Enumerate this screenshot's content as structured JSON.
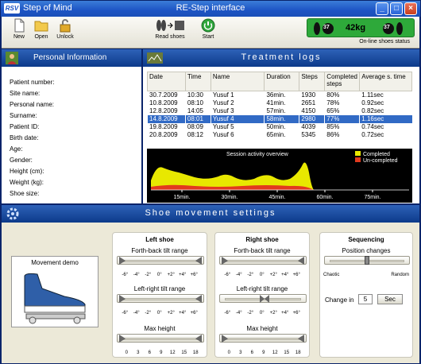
{
  "window": {
    "app_name": "Step of Mind",
    "title": "RE-Step interface",
    "logo_text": "RSV"
  },
  "toolbar": {
    "new_label": "New",
    "open_label": "Open",
    "unlock_label": "Unlock",
    "read_shoes_label": "Read shoes",
    "start_label": "Start",
    "status_label": "On-line shoes status",
    "status_left_text": "37",
    "status_weight_text": "42kg",
    "status_right_text": "37"
  },
  "personal_info": {
    "title": "Personal Information",
    "fields": [
      "Patient number:",
      "Site name:",
      "Personal name:",
      "Surname:",
      "Patient ID:",
      "Birth date:",
      "Age:",
      "Gender:",
      "Height (cm):",
      "Weight (kg):",
      "Shoe size:"
    ]
  },
  "treatment_logs": {
    "title": "Treatment logs",
    "columns": [
      "Date",
      "Time",
      "Name",
      "Duration",
      "Steps",
      "Completed steps",
      "Average s. time"
    ],
    "rows": [
      [
        "30.7.2009",
        "10:30",
        "Yusuf 1",
        "36min.",
        "1930",
        "80%",
        "1.11sec"
      ],
      [
        "10.8.2009",
        "08:10",
        "Yusuf 2",
        "41min.",
        "2651",
        "78%",
        "0.92sec"
      ],
      [
        "12.8.2009",
        "14:05",
        "Yusuf 3",
        "57min.",
        "4150",
        "65%",
        "0.82sec"
      ],
      [
        "14.8.2009",
        "08:01",
        "Yusuf 4",
        "58min.",
        "2980",
        "77%",
        "1.16sec"
      ],
      [
        "19.8.2009",
        "08:09",
        "Yusuf 5",
        "50min.",
        "4039",
        "85%",
        "0.74sec"
      ],
      [
        "20.8.2009",
        "08:12",
        "Yusuf 6",
        "65min.",
        "5345",
        "86%",
        "0.72sec"
      ]
    ],
    "selected_row": 3
  },
  "chart_data": {
    "type": "area",
    "title": "Session activity overview",
    "xlabel": "",
    "ylabel": "",
    "x_ticks": [
      "15min.",
      "30min.",
      "45min.",
      "60min.",
      "75min."
    ],
    "series": [
      {
        "name": "Completed",
        "color": "#e8e800"
      },
      {
        "name": "Un-completed",
        "color": "#e23a1e"
      }
    ]
  },
  "shoe_settings": {
    "title": "Shoe movement settings",
    "movement_demo_label": "Movement demo",
    "left_shoe": {
      "title": "Left shoe",
      "fb_label": "Forth-back tilt range",
      "lr_label": "Left-right tilt range",
      "mh_label": "Max height",
      "tilt_scale": [
        "-6°",
        "-4°",
        "-2°",
        "0°",
        "+2°",
        "+4°",
        "+6°"
      ],
      "height_scale": [
        "0",
        "3",
        "6",
        "9",
        "12",
        "15",
        "18"
      ]
    },
    "right_shoe": {
      "title": "Right shoe",
      "fb_label": "Forth-back tilt range",
      "lr_label": "Left-right tilt range",
      "mh_label": "Max height",
      "tilt_scale": [
        "-6°",
        "-4°",
        "-2°",
        "0°",
        "+2°",
        "+4°",
        "+6°"
      ],
      "height_scale": [
        "0",
        "3",
        "6",
        "9",
        "12",
        "15",
        "18"
      ]
    },
    "sequencing": {
      "title": "Sequencing",
      "position_label": "Position changes",
      "min_label": "Chaotic",
      "max_label": "Random",
      "change_label": "Change in",
      "change_value": "5",
      "unit_button": "Sec"
    }
  }
}
